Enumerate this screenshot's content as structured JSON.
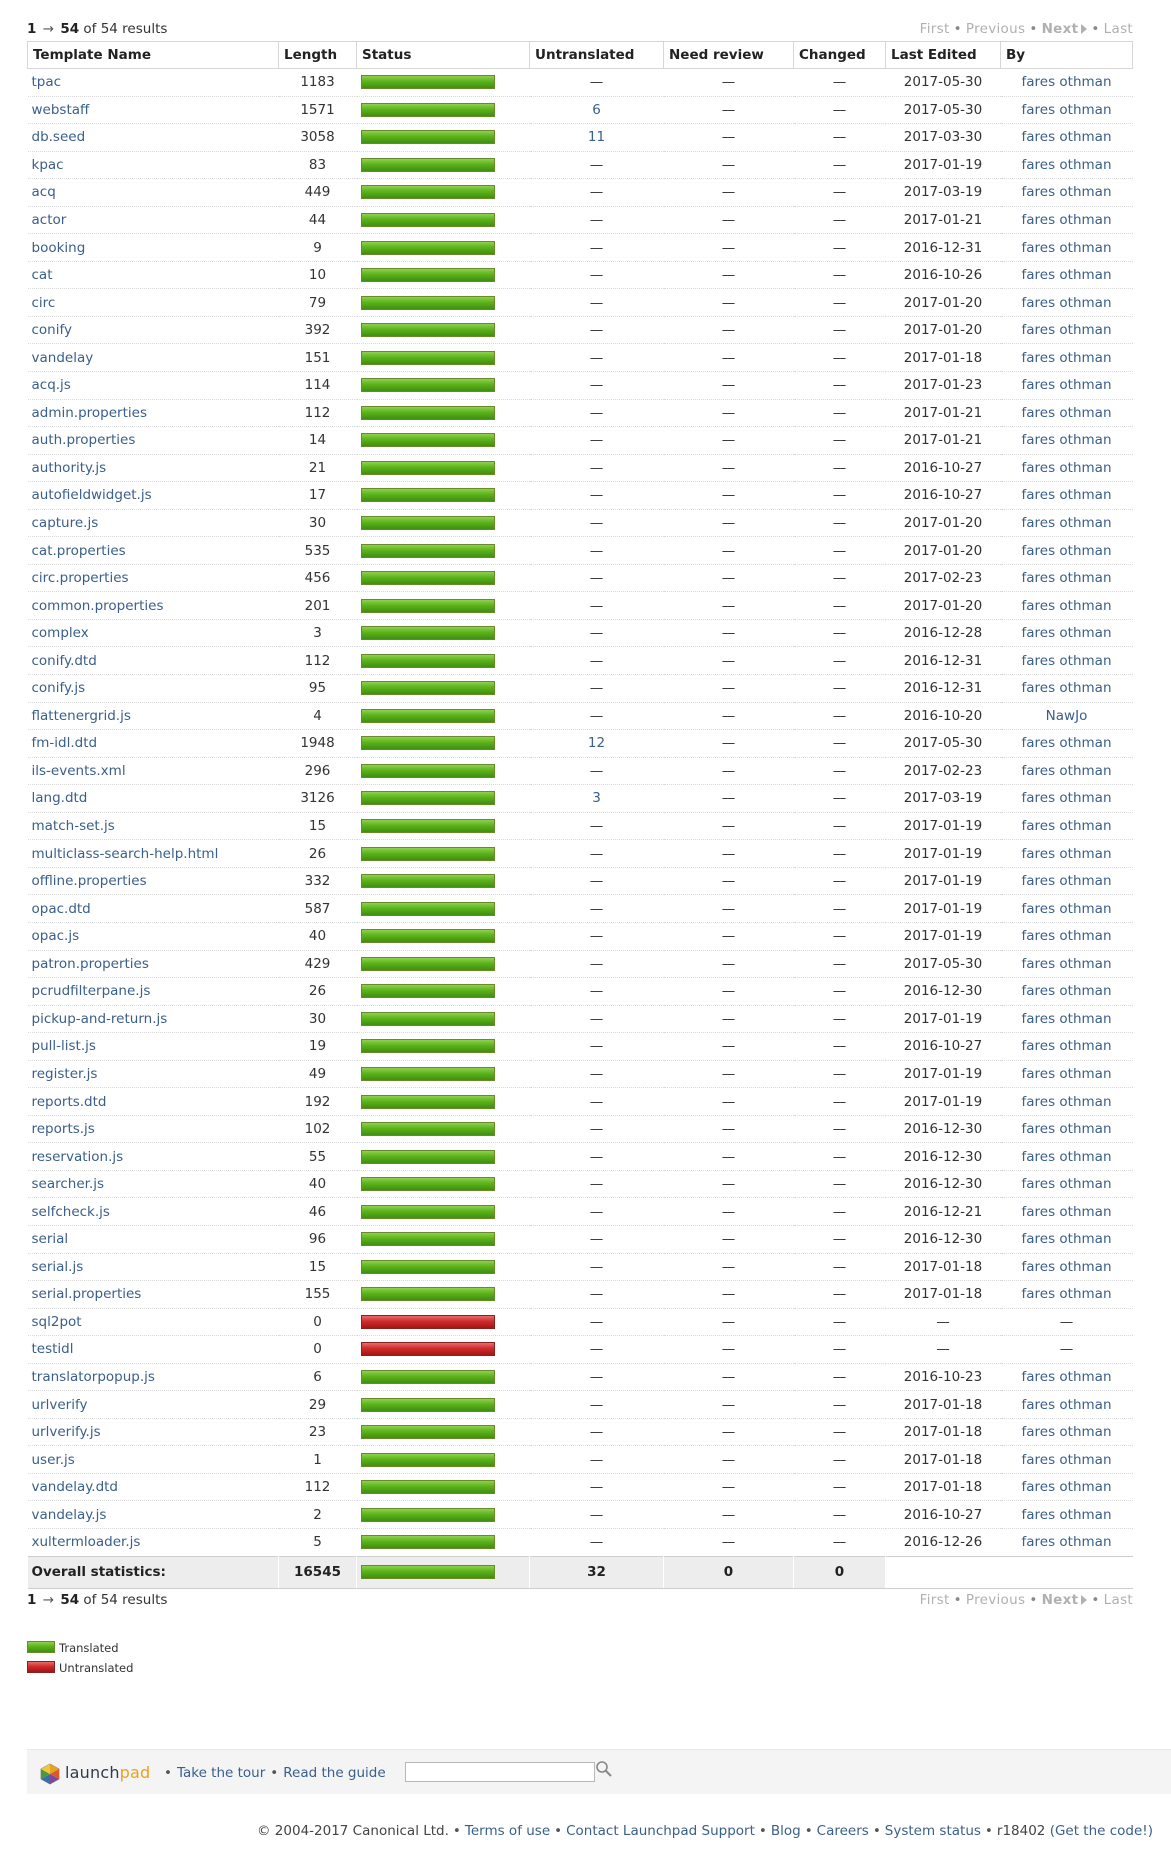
{
  "results": {
    "first": "1",
    "arrow": "→",
    "last": "54",
    "total_text": "of 54 results"
  },
  "nav": {
    "first": "First",
    "previous": "Previous",
    "next": "Next",
    "last": "Last"
  },
  "table": {
    "headers": [
      "Template Name",
      "Length",
      "Status",
      "Untranslated",
      "Need review",
      "Changed",
      "Last Edited",
      "By"
    ],
    "rows": [
      [
        "tpac",
        "1183",
        "green",
        "—",
        "—",
        "—",
        "2017-05-30",
        "fares othman"
      ],
      [
        "webstaff",
        "1571",
        "green",
        "6",
        "—",
        "—",
        "2017-05-30",
        "fares othman"
      ],
      [
        "db.seed",
        "3058",
        "green",
        "11",
        "—",
        "—",
        "2017-03-30",
        "fares othman"
      ],
      [
        "kpac",
        "83",
        "green",
        "—",
        "—",
        "—",
        "2017-01-19",
        "fares othman"
      ],
      [
        "acq",
        "449",
        "green",
        "—",
        "—",
        "—",
        "2017-03-19",
        "fares othman"
      ],
      [
        "actor",
        "44",
        "green",
        "—",
        "—",
        "—",
        "2017-01-21",
        "fares othman"
      ],
      [
        "booking",
        "9",
        "green",
        "—",
        "—",
        "—",
        "2016-12-31",
        "fares othman"
      ],
      [
        "cat",
        "10",
        "green",
        "—",
        "—",
        "—",
        "2016-10-26",
        "fares othman"
      ],
      [
        "circ",
        "79",
        "green",
        "—",
        "—",
        "—",
        "2017-01-20",
        "fares othman"
      ],
      [
        "conify",
        "392",
        "green",
        "—",
        "—",
        "—",
        "2017-01-20",
        "fares othman"
      ],
      [
        "vandelay",
        "151",
        "green",
        "—",
        "—",
        "—",
        "2017-01-18",
        "fares othman"
      ],
      [
        "acq.js",
        "114",
        "green",
        "—",
        "—",
        "—",
        "2017-01-23",
        "fares othman"
      ],
      [
        "admin.properties",
        "112",
        "green",
        "—",
        "—",
        "—",
        "2017-01-21",
        "fares othman"
      ],
      [
        "auth.properties",
        "14",
        "green",
        "—",
        "—",
        "—",
        "2017-01-21",
        "fares othman"
      ],
      [
        "authority.js",
        "21",
        "green",
        "—",
        "—",
        "—",
        "2016-10-27",
        "fares othman"
      ],
      [
        "autofieldwidget.js",
        "17",
        "green",
        "—",
        "—",
        "—",
        "2016-10-27",
        "fares othman"
      ],
      [
        "capture.js",
        "30",
        "green",
        "—",
        "—",
        "—",
        "2017-01-20",
        "fares othman"
      ],
      [
        "cat.properties",
        "535",
        "green",
        "—",
        "—",
        "—",
        "2017-01-20",
        "fares othman"
      ],
      [
        "circ.properties",
        "456",
        "green",
        "—",
        "—",
        "—",
        "2017-02-23",
        "fares othman"
      ],
      [
        "common.properties",
        "201",
        "green",
        "—",
        "—",
        "—",
        "2017-01-20",
        "fares othman"
      ],
      [
        "complex",
        "3",
        "green",
        "—",
        "—",
        "—",
        "2016-12-28",
        "fares othman"
      ],
      [
        "conify.dtd",
        "112",
        "green",
        "—",
        "—",
        "—",
        "2016-12-31",
        "fares othman"
      ],
      [
        "conify.js",
        "95",
        "green",
        "—",
        "—",
        "—",
        "2016-12-31",
        "fares othman"
      ],
      [
        "flattenergrid.js",
        "4",
        "green",
        "—",
        "—",
        "—",
        "2016-10-20",
        "NawJo"
      ],
      [
        "fm-idl.dtd",
        "1948",
        "green",
        "12",
        "—",
        "—",
        "2017-05-30",
        "fares othman"
      ],
      [
        "ils-events.xml",
        "296",
        "green",
        "—",
        "—",
        "—",
        "2017-02-23",
        "fares othman"
      ],
      [
        "lang.dtd",
        "3126",
        "green",
        "3",
        "—",
        "—",
        "2017-03-19",
        "fares othman"
      ],
      [
        "match-set.js",
        "15",
        "green",
        "—",
        "—",
        "—",
        "2017-01-19",
        "fares othman"
      ],
      [
        "multiclass-search-help.html",
        "26",
        "green",
        "—",
        "—",
        "—",
        "2017-01-19",
        "fares othman"
      ],
      [
        "offline.properties",
        "332",
        "green",
        "—",
        "—",
        "—",
        "2017-01-19",
        "fares othman"
      ],
      [
        "opac.dtd",
        "587",
        "green",
        "—",
        "—",
        "—",
        "2017-01-19",
        "fares othman"
      ],
      [
        "opac.js",
        "40",
        "green",
        "—",
        "—",
        "—",
        "2017-01-19",
        "fares othman"
      ],
      [
        "patron.properties",
        "429",
        "green",
        "—",
        "—",
        "—",
        "2017-05-30",
        "fares othman"
      ],
      [
        "pcrudfilterpane.js",
        "26",
        "green",
        "—",
        "—",
        "—",
        "2016-12-30",
        "fares othman"
      ],
      [
        "pickup-and-return.js",
        "30",
        "green",
        "—",
        "—",
        "—",
        "2017-01-19",
        "fares othman"
      ],
      [
        "pull-list.js",
        "19",
        "green",
        "—",
        "—",
        "—",
        "2016-10-27",
        "fares othman"
      ],
      [
        "register.js",
        "49",
        "green",
        "—",
        "—",
        "—",
        "2017-01-19",
        "fares othman"
      ],
      [
        "reports.dtd",
        "192",
        "green",
        "—",
        "—",
        "—",
        "2017-01-19",
        "fares othman"
      ],
      [
        "reports.js",
        "102",
        "green",
        "—",
        "—",
        "—",
        "2016-12-30",
        "fares othman"
      ],
      [
        "reservation.js",
        "55",
        "green",
        "—",
        "—",
        "—",
        "2016-12-30",
        "fares othman"
      ],
      [
        "searcher.js",
        "40",
        "green",
        "—",
        "—",
        "—",
        "2016-12-30",
        "fares othman"
      ],
      [
        "selfcheck.js",
        "46",
        "green",
        "—",
        "—",
        "—",
        "2016-12-21",
        "fares othman"
      ],
      [
        "serial",
        "96",
        "green",
        "—",
        "—",
        "—",
        "2016-12-30",
        "fares othman"
      ],
      [
        "serial.js",
        "15",
        "green",
        "—",
        "—",
        "—",
        "2017-01-18",
        "fares othman"
      ],
      [
        "serial.properties",
        "155",
        "green",
        "—",
        "—",
        "—",
        "2017-01-18",
        "fares othman"
      ],
      [
        "sql2pot",
        "0",
        "red",
        "—",
        "—",
        "—",
        "—",
        "—"
      ],
      [
        "testidl",
        "0",
        "red",
        "—",
        "—",
        "—",
        "—",
        "—"
      ],
      [
        "translatorpopup.js",
        "6",
        "green",
        "—",
        "—",
        "—",
        "2016-10-23",
        "fares othman"
      ],
      [
        "urlverify",
        "29",
        "green",
        "—",
        "—",
        "—",
        "2017-01-18",
        "fares othman"
      ],
      [
        "urlverify.js",
        "23",
        "green",
        "—",
        "—",
        "—",
        "2017-01-18",
        "fares othman"
      ],
      [
        "user.js",
        "1",
        "green",
        "—",
        "—",
        "—",
        "2017-01-18",
        "fares othman"
      ],
      [
        "vandelay.dtd",
        "112",
        "green",
        "—",
        "—",
        "—",
        "2017-01-18",
        "fares othman"
      ],
      [
        "vandelay.js",
        "2",
        "green",
        "—",
        "—",
        "—",
        "2016-10-27",
        "fares othman"
      ],
      [
        "xultermloader.js",
        "5",
        "green",
        "—",
        "—",
        "—",
        "2016-12-26",
        "fares othman"
      ]
    ],
    "summary": {
      "label": "Overall statistics:",
      "length": "16545",
      "untranslated": "32",
      "need_review": "0",
      "changed": "0"
    }
  },
  "legend": {
    "translated": "Translated",
    "untranslated": "Untranslated"
  },
  "footer": {
    "brand_launch": "launch",
    "brand_pad": "pad",
    "take_tour": "Take the tour",
    "read_guide": "Read the guide",
    "search_value": ""
  },
  "copyright": {
    "text": "© 2004-2017 Canonical Ltd.",
    "terms": "Terms of use",
    "support": "Contact Launchpad Support",
    "blog": "Blog",
    "careers": "Careers",
    "status": "System status",
    "revision": "r18402",
    "code": "(Get the code!)"
  },
  "colors": {
    "translated": "#5bb31a",
    "untranslated": "#d02b2b",
    "link": "#3a5f8a",
    "brand_orange": "#e9a21d"
  },
  "icons": [
    "launchpad-logo-icon",
    "search-icon",
    "next-triangle-icon"
  ]
}
